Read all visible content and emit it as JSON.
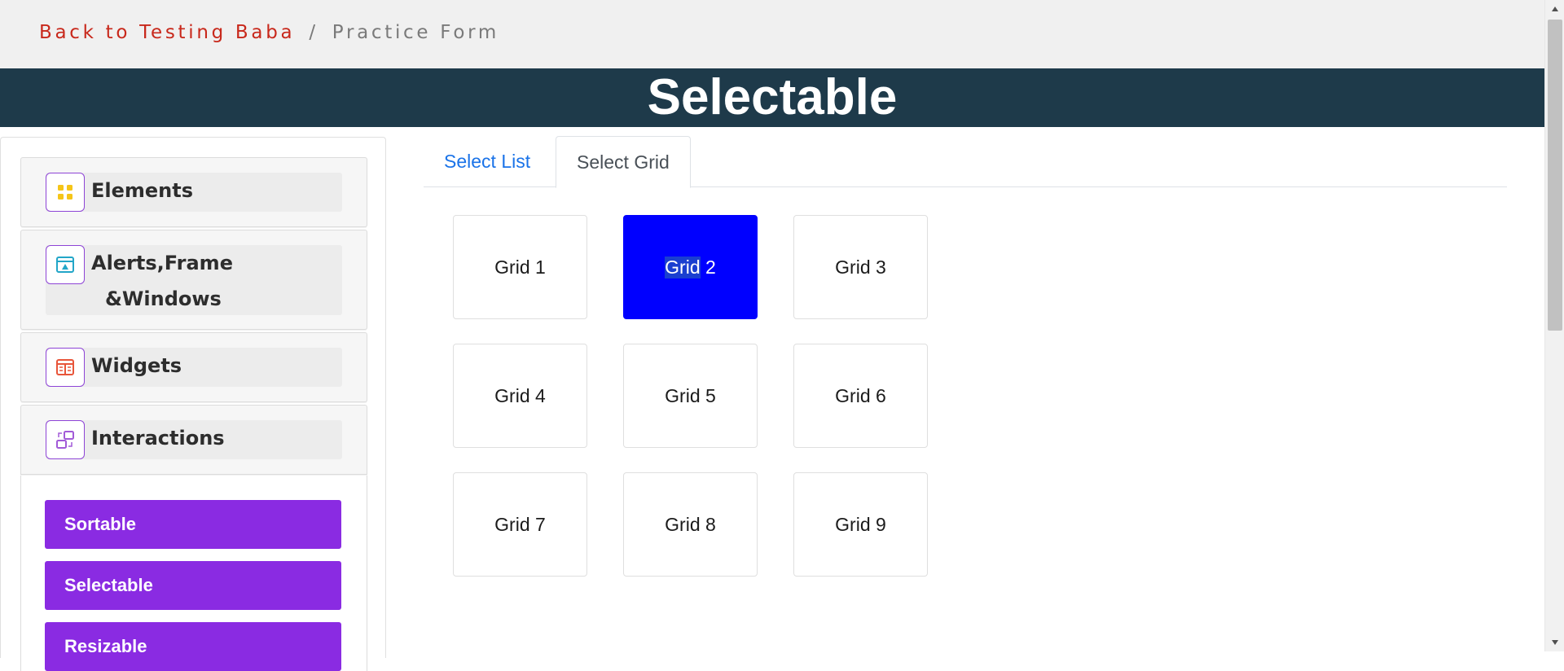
{
  "breadcrumb": {
    "back_label": "Back to Testing Baba",
    "separator": "/",
    "current_label": "Practice Form"
  },
  "header": {
    "title": "Selectable"
  },
  "sidebar": {
    "groups": [
      {
        "label": "Elements",
        "icon": "elements-grid-icon"
      },
      {
        "label_line1": "Alerts,Frame",
        "label_line2": "&Windows",
        "icon": "browser-window-icon"
      },
      {
        "label": "Widgets",
        "icon": "widgets-icon"
      },
      {
        "label": "Interactions",
        "icon": "interactions-icon"
      }
    ],
    "interaction_items": [
      {
        "label": "Sortable"
      },
      {
        "label": "Selectable"
      },
      {
        "label": "Resizable"
      }
    ]
  },
  "tabs": [
    {
      "label": "Select List",
      "active": false
    },
    {
      "label": "Select Grid",
      "active": true
    }
  ],
  "grid": {
    "items": [
      {
        "label": "Grid 1",
        "selected": false
      },
      {
        "label": "Grid 2",
        "selected": true
      },
      {
        "label": "Grid 3",
        "selected": false
      },
      {
        "label": "Grid 4",
        "selected": false
      },
      {
        "label": "Grid 5",
        "selected": false
      },
      {
        "label": "Grid 6",
        "selected": false
      },
      {
        "label": "Grid 7",
        "selected": false
      },
      {
        "label": "Grid 8",
        "selected": false
      },
      {
        "label": "Grid 9",
        "selected": false
      }
    ],
    "selected_text_part": "Grid",
    "selected_number_part": "2"
  },
  "colors": {
    "breadcrumb_link": "#c8281b",
    "banner_bg": "#1e3a4a",
    "menu_button_bg": "#8a2be2",
    "tab_link": "#1a73e8",
    "selected_cell_bg": "#0000ff"
  }
}
